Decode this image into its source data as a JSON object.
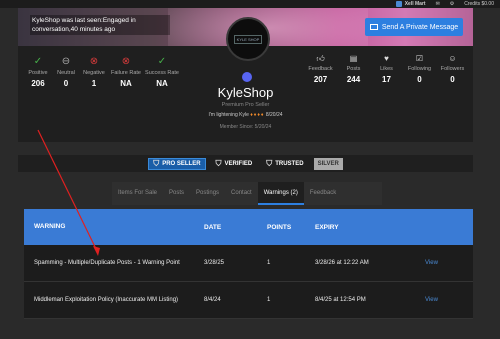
{
  "topbar": {
    "user": "Xell Mart",
    "credits": "Credits $0.00"
  },
  "banner": {
    "last_seen": "KyleShop was last seen:Engaged in conversation,40 minutes ago",
    "pm_button": "Send A Private Message"
  },
  "profile": {
    "username": "KyleShop",
    "title": "Premium Pro Seller",
    "status_text": "I'm lightening Kyle",
    "status_date": "8/20/24",
    "member_since": "Member Since: 5/20/24",
    "avatar_text": "KYLE SHOP",
    "left_stats": [
      {
        "label": "Positive",
        "value": "206",
        "icon": "check-icon"
      },
      {
        "label": "Neutral",
        "value": "0",
        "icon": "neutral-icon"
      },
      {
        "label": "Negative",
        "value": "1",
        "icon": "x-icon"
      },
      {
        "label": "Failure Rate",
        "value": "NA",
        "icon": "x-icon"
      },
      {
        "label": "Success Rate",
        "value": "NA",
        "icon": "check-icon"
      }
    ],
    "right_stats": [
      {
        "label": "Feedback",
        "value": "207",
        "icon": "thumbs-up-icon"
      },
      {
        "label": "Posts",
        "value": "244",
        "icon": "posts-icon"
      },
      {
        "label": "Likes",
        "value": "17",
        "icon": "heart-icon"
      },
      {
        "label": "Following",
        "value": "0",
        "icon": "following-icon"
      },
      {
        "label": "Followers",
        "value": "0",
        "icon": "followers-icon"
      }
    ]
  },
  "badges": [
    "PRO SELLER",
    "VERIFIED",
    "TRUSTED",
    "SILVER"
  ],
  "tabs": [
    "Items For Sale",
    "Posts",
    "Postings",
    "Contact",
    "Warnings (2)",
    "Feedback"
  ],
  "active_tab": "Warnings (2)",
  "table": {
    "headers": [
      "WARNING",
      "DATE",
      "POINTS",
      "EXPIRY",
      ""
    ],
    "rows": [
      {
        "warning": "Spamming - Multiple/Duplicate Posts - 1 Warning Point",
        "date": "3/28/25",
        "points": "1",
        "expiry": "3/28/26 at 12:22 AM",
        "action": "View"
      },
      {
        "warning": "Middleman Exploitation Policy (Inaccurate MM Listing)",
        "date": "8/4/24",
        "points": "1",
        "expiry": "8/4/25 at 12:54 PM",
        "action": "View"
      }
    ]
  },
  "colors": {
    "accent": "#3a7bd5",
    "positive": "#46b04a",
    "negative": "#d43b3b",
    "arrow": "#e02020"
  }
}
